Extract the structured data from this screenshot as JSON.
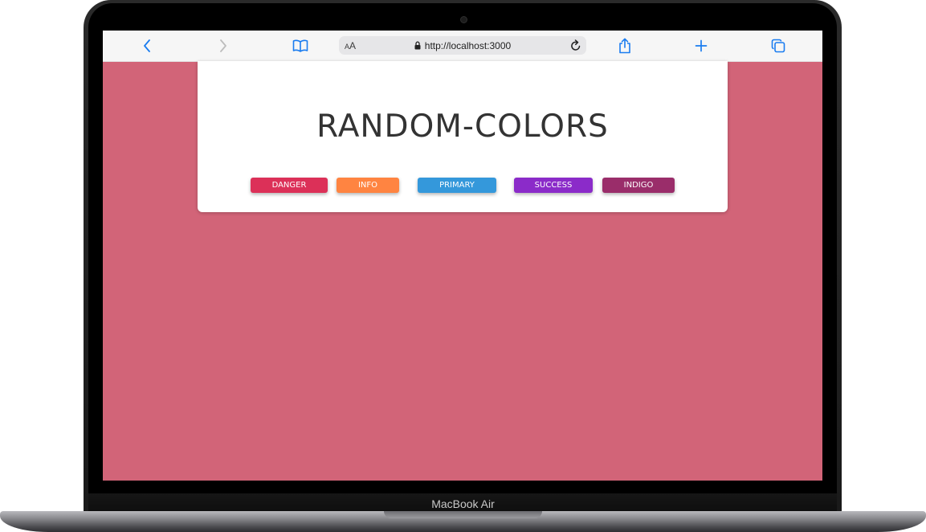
{
  "device": {
    "label": "MacBook Air"
  },
  "browser": {
    "text_size_small": "A",
    "text_size_large": "A",
    "url": "http://localhost:3000",
    "icons": {
      "back": "chevron-left-icon",
      "forward": "chevron-right-icon",
      "bookmarks": "book-icon",
      "lock": "lock-icon",
      "reload": "reload-icon",
      "share": "share-icon",
      "new_tab": "plus-icon",
      "tabs": "tabs-icon"
    },
    "accent_color": "#1a7cf0"
  },
  "page": {
    "background_color": "#d26478",
    "title": "RANDOM-COLORS",
    "buttons": [
      {
        "label": "DANGER",
        "color": "#dc3058"
      },
      {
        "label": "INFO",
        "color": "#ff8441"
      },
      {
        "label": "PRIMARY",
        "color": "#3498db"
      },
      {
        "label": "SUCCESS",
        "color": "#8b2bc9"
      },
      {
        "label": "INDIGO",
        "color": "#9a2d6a"
      }
    ]
  }
}
